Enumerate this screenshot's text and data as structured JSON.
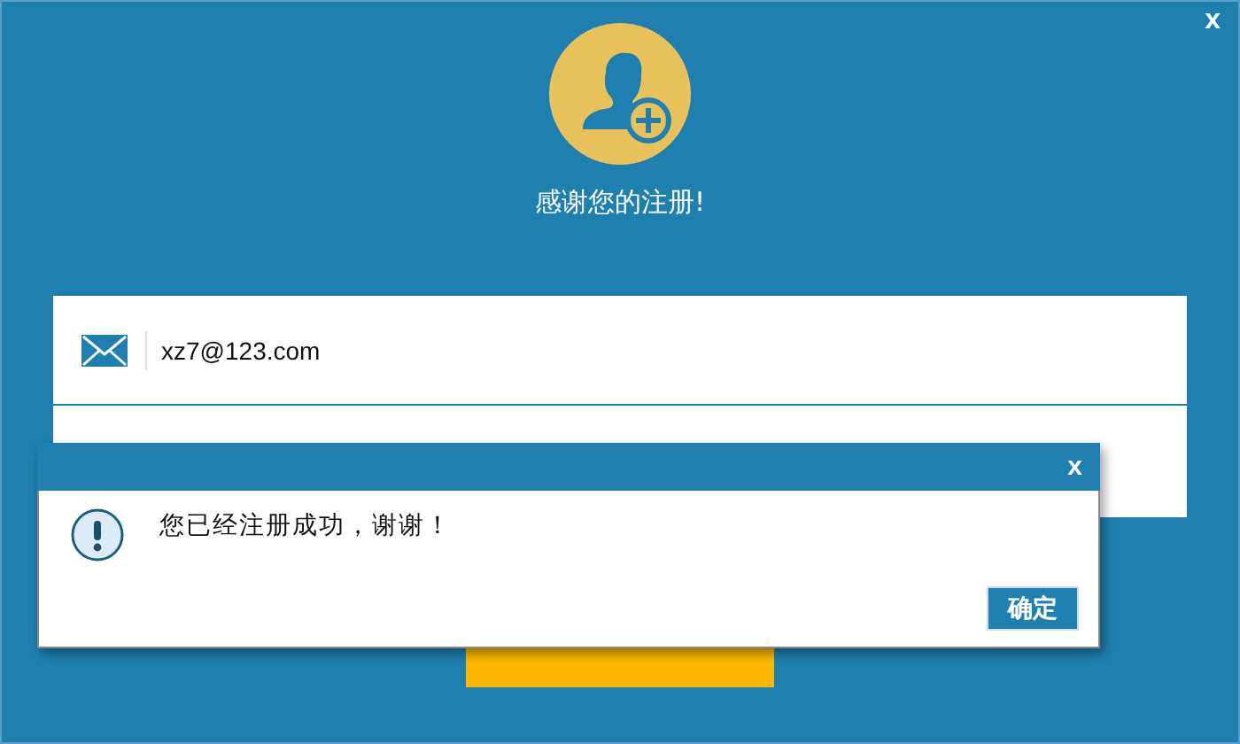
{
  "window": {
    "close": "x",
    "title": "感谢您的注册!"
  },
  "form": {
    "email": {
      "value": "xz7@123.com"
    }
  },
  "register_button": {
    "kind": "button"
  },
  "dialog": {
    "close": "x",
    "message": "您已经注册成功，谢谢！",
    "ok_button": "确定"
  }
}
